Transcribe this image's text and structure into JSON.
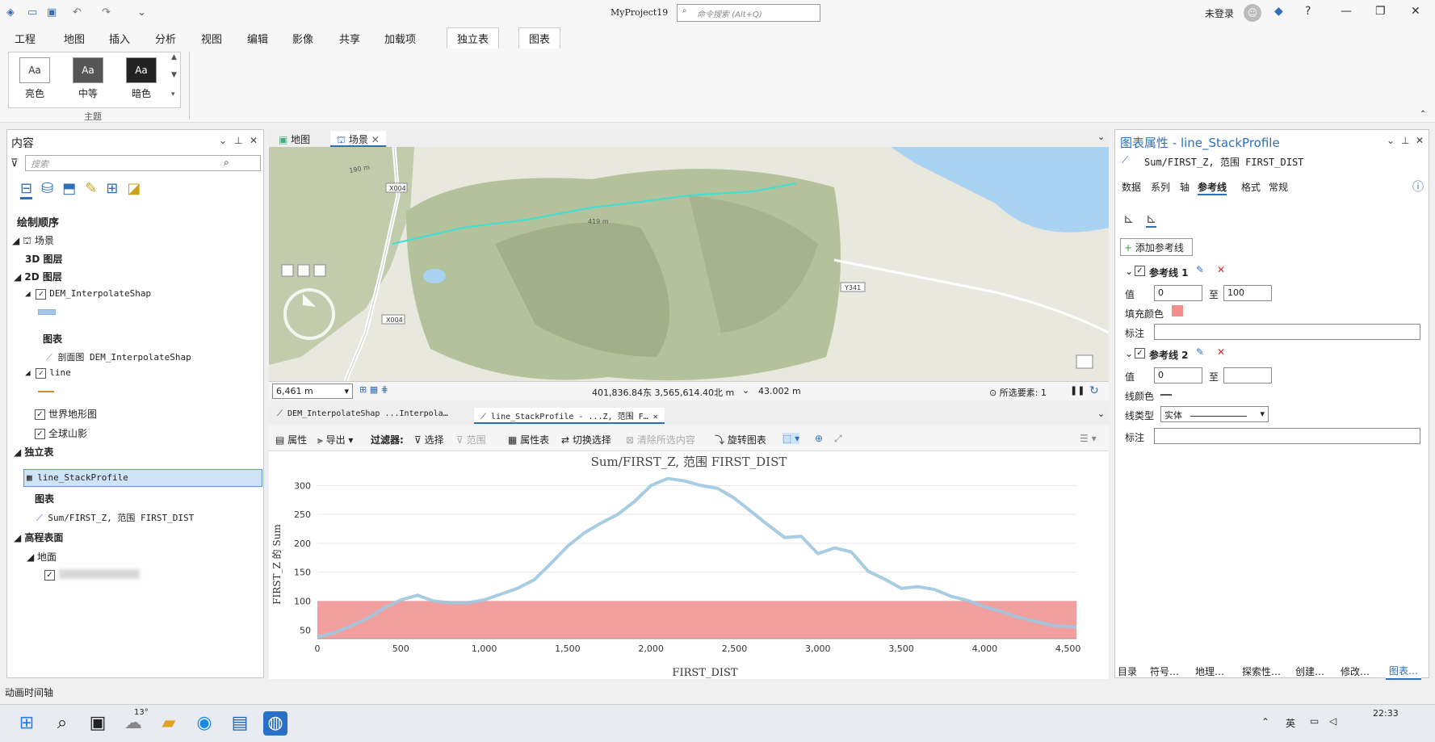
{
  "app": {
    "project": "MyProject19",
    "search_placeholder": "命令搜索 (Alt+Q)",
    "login": "未登录"
  },
  "ribbon_tabs": [
    "工程",
    "地图",
    "插入",
    "分析",
    "视图",
    "编辑",
    "影像",
    "共享",
    "加载项",
    "独立表",
    "图表"
  ],
  "themes": [
    {
      "label": "亮色",
      "glyph": "Aa"
    },
    {
      "label": "中等",
      "glyph": "Aa"
    },
    {
      "label": "暗色",
      "glyph": "Aa"
    }
  ],
  "theme_group": "主题",
  "contents": {
    "title": "内容",
    "search": "搜索",
    "section": "绘制顺序",
    "items": {
      "scene": "场景",
      "layers3d": "3D 图层",
      "layers2d": "2D 图层",
      "dem": "DEM_InterpolateShap",
      "chart_hdr": "图表",
      "dem_chart": "剖面图 DEM_InterpolateShap",
      "line": "line",
      "world_topo": "世界地形图",
      "hillshade": "全球山影",
      "standalone": "独立表",
      "stack": "line_StackProfile",
      "chart_hdr2": "图表",
      "stack_chart": "Sum/FIRST_Z, 范围 FIRST_DIST",
      "elev": "高程表面",
      "ground": "地面"
    }
  },
  "views": {
    "tab_map": "地图",
    "tab_scene": "场景"
  },
  "scene": {
    "labels": [
      "190 m",
      "X004",
      "419 m",
      "X004",
      "Y341"
    ],
    "scale": "6,461 m",
    "coords": "401,836.84东 3,565,614.40北 m",
    "elev": "43.002 m",
    "selected": "所选要素: 1"
  },
  "chart_tabs": [
    "DEM_InterpolateShap ...Interpola…",
    "line_StackProfile - ...Z, 范围 F…"
  ],
  "toolbar": {
    "props": "属性",
    "export": "导出",
    "filter": "过滤器:",
    "select": "选择",
    "extent": "范围",
    "attr_table": "属性表",
    "toggle": "切换选择",
    "clear": "清除所选内容",
    "rotate": "旋转图表"
  },
  "chart_data": {
    "type": "line",
    "title": "Sum/FIRST_Z, 范围 FIRST_DIST",
    "xlabel": "FIRST_DIST",
    "ylabel": "FIRST_Z 的 Sum",
    "xlim": [
      0,
      4550
    ],
    "ylim": [
      35,
      320
    ],
    "xticks": [
      "0",
      "500",
      "1,000",
      "1,500",
      "2,000",
      "2,500",
      "3,000",
      "3,500",
      "4,000",
      "4,500"
    ],
    "yticks": [
      "50",
      "100",
      "150",
      "200",
      "250",
      "300"
    ],
    "x": [
      0,
      100,
      200,
      300,
      400,
      500,
      600,
      700,
      800,
      900,
      1000,
      1100,
      1200,
      1300,
      1400,
      1500,
      1600,
      1700,
      1800,
      1900,
      2000,
      2100,
      2200,
      2300,
      2400,
      2500,
      2600,
      2700,
      2800,
      2900,
      3000,
      3100,
      3200,
      3300,
      3400,
      3500,
      3600,
      3700,
      3800,
      3900,
      4000,
      4100,
      4200,
      4300,
      4400,
      4550
    ],
    "y": [
      38,
      45,
      57,
      70,
      88,
      102,
      110,
      100,
      97,
      97,
      102,
      112,
      122,
      137,
      165,
      195,
      218,
      235,
      250,
      272,
      300,
      312,
      308,
      300,
      295,
      278,
      255,
      232,
      210,
      212,
      182,
      192,
      185,
      152,
      138,
      122,
      125,
      120,
      108,
      101,
      90,
      82,
      72,
      65,
      58,
      55
    ],
    "series": [
      {
        "name": "",
        "color": "#9ec8e0"
      }
    ],
    "reference_band": {
      "from": 0,
      "to": 100,
      "color": "#f08e8e"
    }
  },
  "props": {
    "title": "图表属性 - line_StackProfile",
    "subtitle": "Sum/FIRST_Z, 范围 FIRST_DIST",
    "tabs": [
      "数据",
      "系列",
      "轴",
      "参考线",
      "格式",
      "常规"
    ],
    "add_ref": "添加参考线",
    "ref1": {
      "name": "参考线 1",
      "value_label": "值",
      "from": "0",
      "to_label": "至",
      "to": "100",
      "fill_label": "填充颜色",
      "note_label": "标注"
    },
    "ref2": {
      "name": "参考线 2",
      "value_label": "值",
      "from": "0",
      "to_label": "至",
      "to": "",
      "color_label": "线颜色",
      "type_label": "线类型",
      "type_value": "实体",
      "note_label": "标注"
    }
  },
  "bottom_tabs": [
    "目录",
    "符号…",
    "地理…",
    "探索性…",
    "创建…",
    "修改…",
    "图表…"
  ],
  "status": {
    "anim": "动画时间轴"
  },
  "taskbar": {
    "time": "22:33",
    "weather": "13°",
    "lang": "英"
  }
}
